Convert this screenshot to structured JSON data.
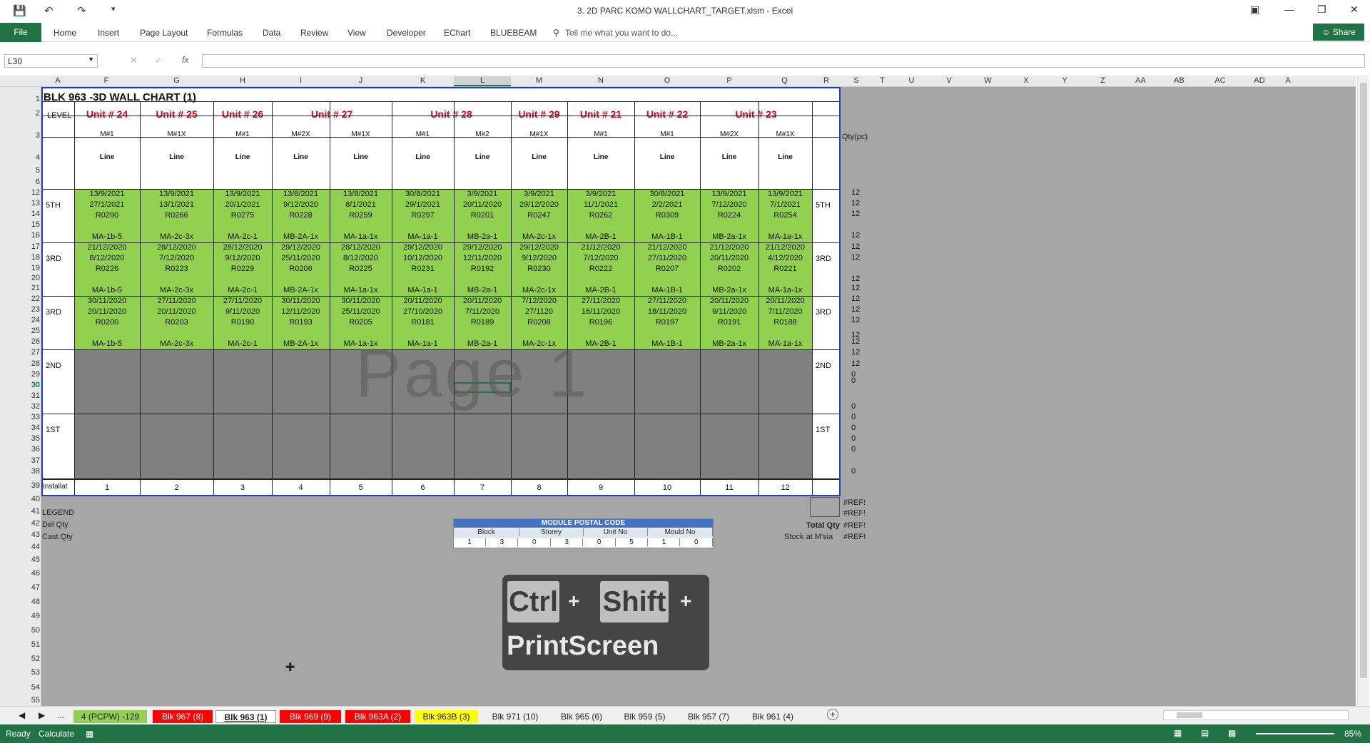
{
  "window": {
    "title": "3. 2D PARC KOMO WALLCHART_TARGET.xlsm - Excel"
  },
  "ribbon": {
    "file": "File",
    "tabs": [
      "Home",
      "Insert",
      "Page Layout",
      "Formulas",
      "Data",
      "Review",
      "View",
      "Developer",
      "EChart",
      "BLUEBEAM"
    ],
    "tell_me": "Tell me what you want to do...",
    "share": "Share"
  },
  "formula_bar": {
    "name_box": "L30",
    "fx": "fx",
    "value": ""
  },
  "outline_levels": [
    "1",
    "2"
  ],
  "columns": [
    "A",
    "F",
    "G",
    "H",
    "I",
    "J",
    "K",
    "L",
    "M",
    "N",
    "O",
    "P",
    "Q",
    "R",
    "S",
    "T",
    "U",
    "V",
    "W",
    "X",
    "Y",
    "Z",
    "AA",
    "AB",
    "AC",
    "AD",
    "A"
  ],
  "rows": [
    "1",
    "2",
    "3",
    "4",
    "5",
    "6",
    "12",
    "13",
    "14",
    "15",
    "16",
    "17",
    "18",
    "19",
    "20",
    "21",
    "22",
    "23",
    "24",
    "25",
    "26",
    "27",
    "28",
    "29",
    "30",
    "31",
    "32",
    "33",
    "34",
    "35",
    "36",
    "37",
    "38",
    "39",
    "40",
    "41",
    "42",
    "43",
    "44",
    "45",
    "46",
    "47",
    "48",
    "49",
    "50",
    "51",
    "52",
    "53",
    "54",
    "55"
  ],
  "sheet": {
    "title": "BLK 963 -3D WALL CHART (1)",
    "level_label": "LEVEL",
    "units": [
      "Unit # 24",
      "Unit # 25",
      "Unit # 26",
      "Unit # 27",
      "Unit # 28",
      "Unit # 29",
      "Unit # 21",
      "Unit # 22",
      "Unit # 23"
    ],
    "moulds": [
      "M#1",
      "M#1X",
      "M#1",
      "M#2X",
      "M#1X",
      "M#1",
      "M#2",
      "M#1X",
      "M#1",
      "M#1",
      "M#2X",
      "M#1X"
    ],
    "lines": [
      "Line",
      "Line",
      "Line",
      "Line",
      "Line",
      "Line",
      "Line",
      "Line",
      "Line",
      "Line",
      "Line",
      "Line"
    ],
    "bands": [
      {
        "level": "5TH",
        "right_level": "5TH",
        "d1": [
          "13/9/2021",
          "13/9/2021",
          "13/9/2021",
          "13/8/2021",
          "13/8/2021",
          "30/8/2021",
          "3/9/2021",
          "3/9/2021",
          "3/9/2021",
          "30/8/2021",
          "13/9/2021",
          "13/9/2021"
        ],
        "d2": [
          "27/1/2021",
          "13/1/2021",
          "20/1/2021",
          "9/12/2020",
          "8/1/2021",
          "29/1/2021",
          "20/11/2020",
          "29/12/2020",
          "11/1/2021",
          "2/2/2021",
          "7/12/2020",
          "7/1/2021"
        ],
        "r": [
          "R0290",
          "R0266",
          "R0275",
          "R0228",
          "R0259",
          "R0297",
          "R0201",
          "R0247",
          "R0262",
          "R0309",
          "R0224",
          "R0254"
        ],
        "m": [
          "MA-1b-5",
          "MA-2c-3x",
          "MA-2c-1",
          "MB-2A-1x",
          "MA-1a-1x",
          "MA-1a-1",
          "MB-2a-1",
          "MA-2c-1x",
          "MA-2B-1",
          "MA-1B-1",
          "MB-2a-1x",
          "MA-1a-1x"
        ]
      },
      {
        "level": "3RD",
        "right_level": "3RD",
        "d1": [
          "21/12/2020",
          "28/12/2020",
          "28/12/2020",
          "29/12/2020",
          "28/12/2020",
          "29/12/2020",
          "29/12/2020",
          "29/12/2020",
          "21/12/2020",
          "21/12/2020",
          "21/12/2020",
          "21/12/2020"
        ],
        "d2": [
          "8/12/2020",
          "7/12/2020",
          "9/12/2020",
          "25/11/2020",
          "8/12/2020",
          "10/12/2020",
          "12/11/2020",
          "9/12/2020",
          "7/12/2020",
          "27/11/2020",
          "20/11/2020",
          "4/12/2020"
        ],
        "r": [
          "R0226",
          "R0223",
          "R0229",
          "R0206",
          "R0225",
          "R0231",
          "R0192",
          "R0230",
          "R0222",
          "R0207",
          "R0202",
          "R0221"
        ],
        "m": [
          "MA-1b-5",
          "MA-2c-3x",
          "MA-2c-1",
          "MB-2A-1x",
          "MA-1a-1x",
          "MA-1a-1",
          "MB-2a-1",
          "MA-2c-1x",
          "MA-2B-1",
          "MA-1B-1",
          "MB-2a-1x",
          "MA-1a-1x"
        ]
      },
      {
        "level": "3RD",
        "right_level": "3RD",
        "d1": [
          "30/11/2020",
          "27/11/2020",
          "27/11/2020",
          "30/11/2020",
          "30/11/2020",
          "20/11/2020",
          "20/11/2020",
          "7/12/2020",
          "27/11/2020",
          "27/11/2020",
          "20/11/2020",
          "20/11/2020"
        ],
        "d2": [
          "20/11/2020",
          "20/11/2020",
          "9/11/2020",
          "12/11/2020",
          "25/11/2020",
          "27/10/2020",
          "7/11/2020",
          "27/1120",
          "16/11/2020",
          "18/11/2020",
          "9/11/2020",
          "7/11/2020"
        ],
        "r": [
          "R0200",
          "R0203",
          "R0190",
          "R0193",
          "R0205",
          "R0181",
          "R0189",
          "R0208",
          "R0196",
          "R0197",
          "R0191",
          "R0188"
        ],
        "m": [
          "MA-1b-5",
          "MA-2c-3x",
          "MA-2c-1",
          "MB-2A-1x",
          "MA-1a-1x",
          "MA-1a-1",
          "MB-2a-1",
          "MA-2c-1x",
          "MA-2B-1",
          "MA-1B-1",
          "MB-2a-1x",
          "MA-1a-1x"
        ]
      }
    ],
    "level_2nd": "2ND",
    "level_1st": "1ST",
    "install_label": "Installat",
    "install_numbers": [
      "1",
      "2",
      "3",
      "4",
      "5",
      "6",
      "7",
      "8",
      "9",
      "10",
      "11",
      "12"
    ],
    "qty_header": "Qty(pc)",
    "qty": [
      "12",
      "12",
      "12",
      "12",
      "12",
      "12",
      "12",
      "12",
      "12",
      "12",
      "12",
      "12",
      "12",
      "12",
      "12",
      "0",
      "0",
      "0",
      "0",
      "0",
      "0",
      "0",
      "0"
    ],
    "footer_left": [
      "LEGEND",
      "Del Qty",
      "Cast Qty"
    ],
    "ref_values": [
      "#REF!",
      "#REF!",
      "#REF!",
      "#REF!"
    ],
    "total_qty": "Total Qty",
    "stock": "Stock at M'sia",
    "watermark": "Page 1"
  },
  "module_postal_code": {
    "title": "MODULE POSTAL CODE",
    "headers": [
      "Block",
      "Storey",
      "Unit No",
      "Mould No"
    ],
    "values": [
      "1",
      "3",
      "0",
      "3",
      "0",
      "5",
      "1",
      "0"
    ]
  },
  "shortcut": {
    "ctrl": "Ctrl",
    "shift": "Shift",
    "plus": "+",
    "print": "PrintScreen"
  },
  "sheet_tabs": [
    {
      "label": "4 (PCPW) -129",
      "color": "#92d050"
    },
    {
      "label": "Blk 967 (8)",
      "color": "#ff0000"
    },
    {
      "label": "Blk 963 (1)",
      "color": "#ffffff"
    },
    {
      "label": "Blk 969 (9)",
      "color": "#ff0000"
    },
    {
      "label": "Blk 963A (2)",
      "color": "#ff0000"
    },
    {
      "label": "Blk 963B (3)",
      "color": "#ffff00"
    },
    {
      "label": "Blk 971 (10)",
      "color": "#f0f0f0"
    },
    {
      "label": "Blk 965 (6)",
      "color": "#f0f0f0"
    },
    {
      "label": "Blk 959 (5)",
      "color": "#f0f0f0"
    },
    {
      "label": "Blk 957 (7)",
      "color": "#f0f0f0"
    },
    {
      "label": "Blk 961 (4)",
      "color": "#f0f0f0"
    }
  ],
  "tabs_more": "...",
  "status": {
    "ready": "Ready",
    "calculate": "Calculate",
    "zoom": "85%"
  }
}
